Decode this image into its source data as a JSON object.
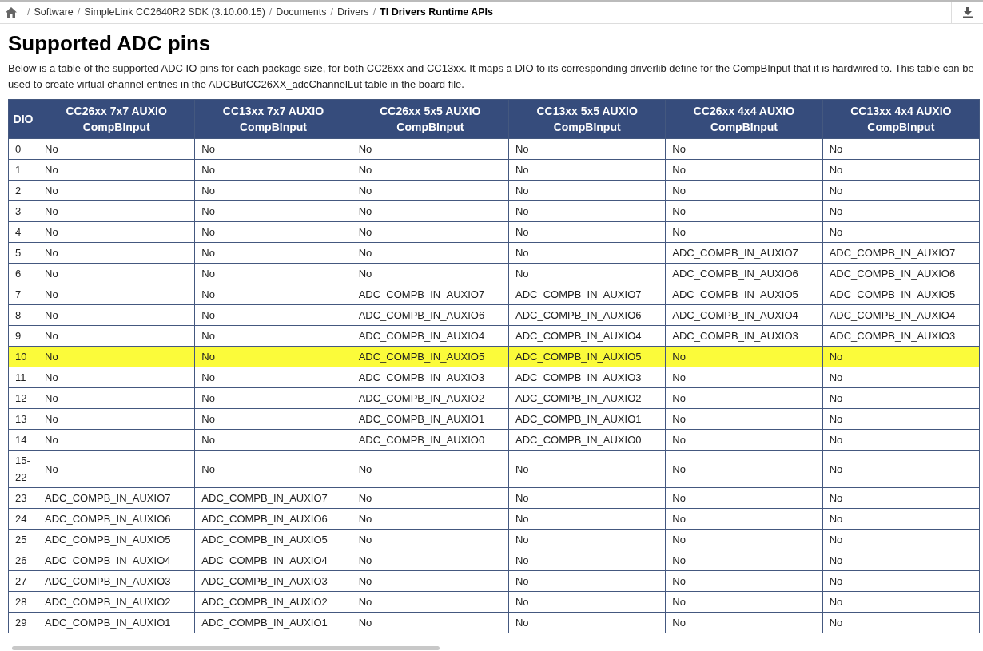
{
  "breadcrumb_separator": "/",
  "breadcrumb": [
    "Software",
    "SimpleLink CC2640R2 SDK (3.10.00.15)",
    "Documents",
    "Drivers",
    "TI Drivers Runtime APIs"
  ],
  "title": "Supported ADC pins",
  "intro": "Below is a table of the supported ADC IO pins for each package size, for both CC26xx and CC13xx. It maps a DIO to its corresponding driverlib define for the CompBInput that it is hardwired to. This table can be used to create virtual channel entries in the ADCBufCC26XX_adcChannelLut table in the board file.",
  "table": {
    "columns": [
      "DIO",
      "CC26xx 7x7 AUXIO CompBInput",
      "CC13xx 7x7 AUXIO CompBInput",
      "CC26xx 5x5 AUXIO CompBInput",
      "CC13xx 5x5 AUXIO CompBInput",
      "CC26xx 4x4 AUXIO CompBInput",
      "CC13xx 4x4 AUXIO CompBInput"
    ],
    "rows": [
      {
        "cells": [
          "0",
          "No",
          "No",
          "No",
          "No",
          "No",
          "No"
        ],
        "highlighted": false
      },
      {
        "cells": [
          "1",
          "No",
          "No",
          "No",
          "No",
          "No",
          "No"
        ],
        "highlighted": false
      },
      {
        "cells": [
          "2",
          "No",
          "No",
          "No",
          "No",
          "No",
          "No"
        ],
        "highlighted": false
      },
      {
        "cells": [
          "3",
          "No",
          "No",
          "No",
          "No",
          "No",
          "No"
        ],
        "highlighted": false
      },
      {
        "cells": [
          "4",
          "No",
          "No",
          "No",
          "No",
          "No",
          "No"
        ],
        "highlighted": false
      },
      {
        "cells": [
          "5",
          "No",
          "No",
          "No",
          "No",
          "ADC_COMPB_IN_AUXIO7",
          "ADC_COMPB_IN_AUXIO7"
        ],
        "highlighted": false
      },
      {
        "cells": [
          "6",
          "No",
          "No",
          "No",
          "No",
          "ADC_COMPB_IN_AUXIO6",
          "ADC_COMPB_IN_AUXIO6"
        ],
        "highlighted": false
      },
      {
        "cells": [
          "7",
          "No",
          "No",
          "ADC_COMPB_IN_AUXIO7",
          "ADC_COMPB_IN_AUXIO7",
          "ADC_COMPB_IN_AUXIO5",
          "ADC_COMPB_IN_AUXIO5"
        ],
        "highlighted": false
      },
      {
        "cells": [
          "8",
          "No",
          "No",
          "ADC_COMPB_IN_AUXIO6",
          "ADC_COMPB_IN_AUXIO6",
          "ADC_COMPB_IN_AUXIO4",
          "ADC_COMPB_IN_AUXIO4"
        ],
        "highlighted": false
      },
      {
        "cells": [
          "9",
          "No",
          "No",
          "ADC_COMPB_IN_AUXIO4",
          "ADC_COMPB_IN_AUXIO4",
          "ADC_COMPB_IN_AUXIO3",
          "ADC_COMPB_IN_AUXIO3"
        ],
        "highlighted": false
      },
      {
        "cells": [
          "10",
          "No",
          "No",
          "ADC_COMPB_IN_AUXIO5",
          "ADC_COMPB_IN_AUXIO5",
          "No",
          "No"
        ],
        "highlighted": true
      },
      {
        "cells": [
          "11",
          "No",
          "No",
          "ADC_COMPB_IN_AUXIO3",
          "ADC_COMPB_IN_AUXIO3",
          "No",
          "No"
        ],
        "highlighted": false
      },
      {
        "cells": [
          "12",
          "No",
          "No",
          "ADC_COMPB_IN_AUXIO2",
          "ADC_COMPB_IN_AUXIO2",
          "No",
          "No"
        ],
        "highlighted": false
      },
      {
        "cells": [
          "13",
          "No",
          "No",
          "ADC_COMPB_IN_AUXIO1",
          "ADC_COMPB_IN_AUXIO1",
          "No",
          "No"
        ],
        "highlighted": false
      },
      {
        "cells": [
          "14",
          "No",
          "No",
          "ADC_COMPB_IN_AUXIO0",
          "ADC_COMPB_IN_AUXIO0",
          "No",
          "No"
        ],
        "highlighted": false
      },
      {
        "cells": [
          "15-22",
          "No",
          "No",
          "No",
          "No",
          "No",
          "No"
        ],
        "highlighted": false
      },
      {
        "cells": [
          "23",
          "ADC_COMPB_IN_AUXIO7",
          "ADC_COMPB_IN_AUXIO7",
          "No",
          "No",
          "No",
          "No"
        ],
        "highlighted": false
      },
      {
        "cells": [
          "24",
          "ADC_COMPB_IN_AUXIO6",
          "ADC_COMPB_IN_AUXIO6",
          "No",
          "No",
          "No",
          "No"
        ],
        "highlighted": false
      },
      {
        "cells": [
          "25",
          "ADC_COMPB_IN_AUXIO5",
          "ADC_COMPB_IN_AUXIO5",
          "No",
          "No",
          "No",
          "No"
        ],
        "highlighted": false
      },
      {
        "cells": [
          "26",
          "ADC_COMPB_IN_AUXIO4",
          "ADC_COMPB_IN_AUXIO4",
          "No",
          "No",
          "No",
          "No"
        ],
        "highlighted": false
      },
      {
        "cells": [
          "27",
          "ADC_COMPB_IN_AUXIO3",
          "ADC_COMPB_IN_AUXIO3",
          "No",
          "No",
          "No",
          "No"
        ],
        "highlighted": false
      },
      {
        "cells": [
          "28",
          "ADC_COMPB_IN_AUXIO2",
          "ADC_COMPB_IN_AUXIO2",
          "No",
          "No",
          "No",
          "No"
        ],
        "highlighted": false
      },
      {
        "cells": [
          "29",
          "ADC_COMPB_IN_AUXIO1",
          "ADC_COMPB_IN_AUXIO1",
          "No",
          "No",
          "No",
          "No"
        ],
        "highlighted": false
      }
    ]
  }
}
